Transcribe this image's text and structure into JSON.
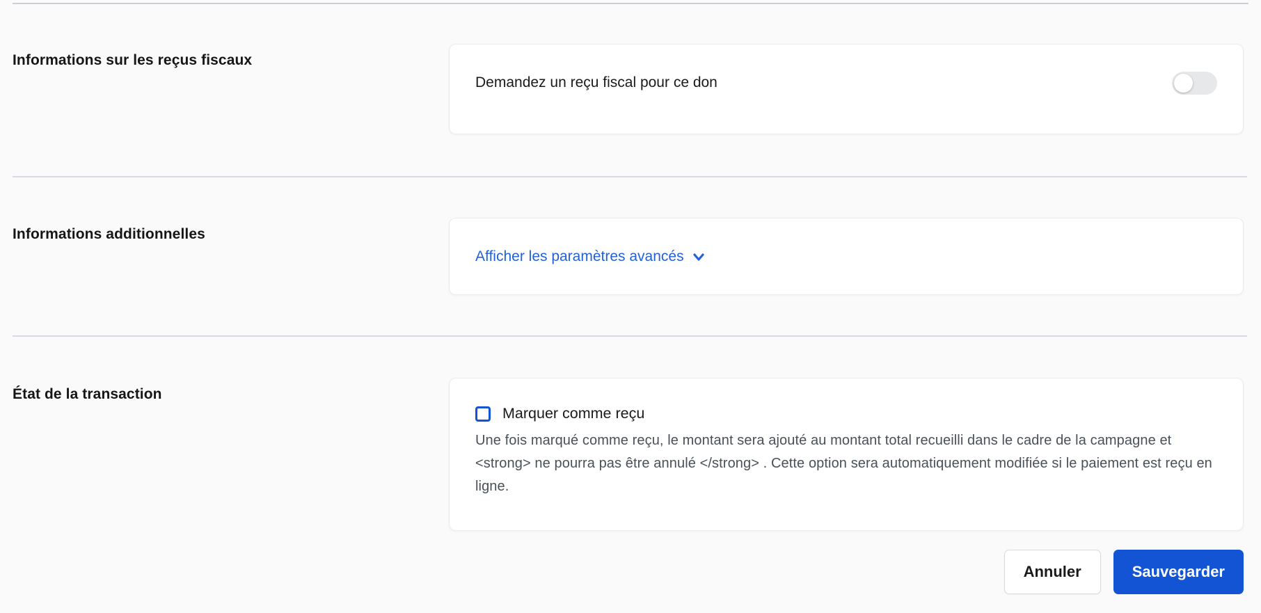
{
  "colors": {
    "page_background": "#fafafa",
    "accent_blue": "#1254d4",
    "link_blue": "#2262d9",
    "toggle_track_off": "#e7e8ea",
    "divider": "#d7dbe1",
    "description_gray": "#4a5058"
  },
  "sections": [
    {
      "label": "Informations sur les reçus fiscaux",
      "card": {
        "toggle_text": "Demandez un reçu fiscal pour ce don",
        "toggle_icon": "toggle-off-icon",
        "toggle_enabled": false
      }
    },
    {
      "label": "Informations additionnelles",
      "card": {
        "link_label": "Afficher les paramètres avancés",
        "link_icon": "chevron-down-icon",
        "expanded": false
      }
    },
    {
      "label": "État de la transaction",
      "card": {
        "checkbox_label": "Marquer comme reçu",
        "checkbox_checked": false,
        "description": "Une fois marqué comme reçu, le montant sera ajouté au montant total recueilli dans le cadre de la campagne et <strong> ne pourra pas être annulé </strong> . Cette option sera automatiquement modifiée si le paiement est reçu en ligne."
      }
    }
  ],
  "footer": {
    "cancel_label": "Annuler",
    "save_label": "Sauvegarder"
  }
}
